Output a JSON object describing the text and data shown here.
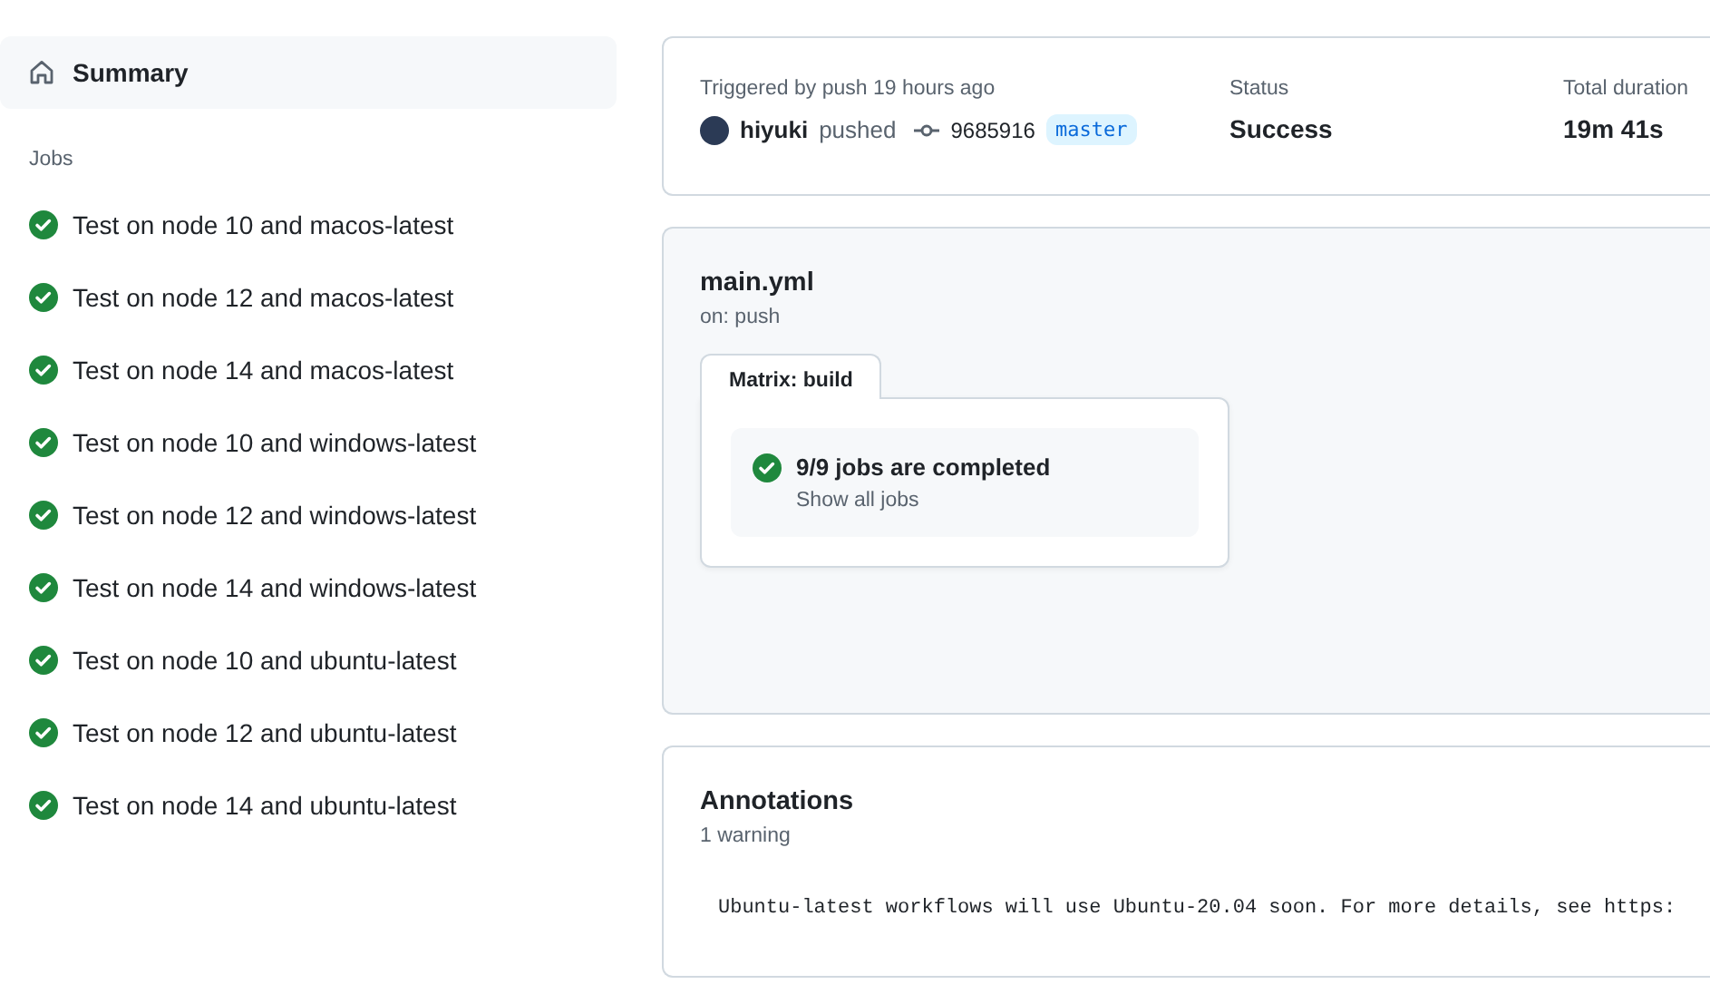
{
  "sidebar": {
    "summary": {
      "label": "Summary",
      "selected": true
    },
    "jobs_heading": "Jobs",
    "jobs": [
      {
        "label": "Test on node 10 and macos-latest",
        "completed": true
      },
      {
        "label": "Test on node 12 and macos-latest",
        "completed": true
      },
      {
        "label": "Test on node 14 and macos-latest",
        "completed": true
      },
      {
        "label": "Test on node 10 and windows-latest",
        "completed": true
      },
      {
        "label": "Test on node 12 and windows-latest",
        "completed": true
      },
      {
        "label": "Test on node 14 and windows-latest",
        "completed": true
      },
      {
        "label": "Test on node 10 and ubuntu-latest",
        "completed": true
      },
      {
        "label": "Test on node 12 and ubuntu-latest",
        "completed": true
      },
      {
        "label": "Test on node 14 and ubuntu-latest",
        "completed": true
      }
    ]
  },
  "run_info": {
    "trigger": "Triggered by push 19 hours ago",
    "user": "hiyuki",
    "action": "pushed",
    "commit": "9685916",
    "branch": "master",
    "status_label": "Status",
    "status": "Success",
    "duration_label": "Total duration",
    "duration": "19m 41s"
  },
  "workflow": {
    "file": "main.yml",
    "event": "on: push",
    "matrix": {
      "tab": "Matrix: build",
      "summary": "9/9 jobs are completed",
      "completed": true,
      "link": "Show all jobs"
    }
  },
  "annotations": {
    "title": "Annotations",
    "count": "1 warning",
    "items": [
      {
        "kind": "warning",
        "message": "Ubuntu-latest workflows will use Ubuntu-20.04 soon. For more details, see https:"
      }
    ]
  }
}
